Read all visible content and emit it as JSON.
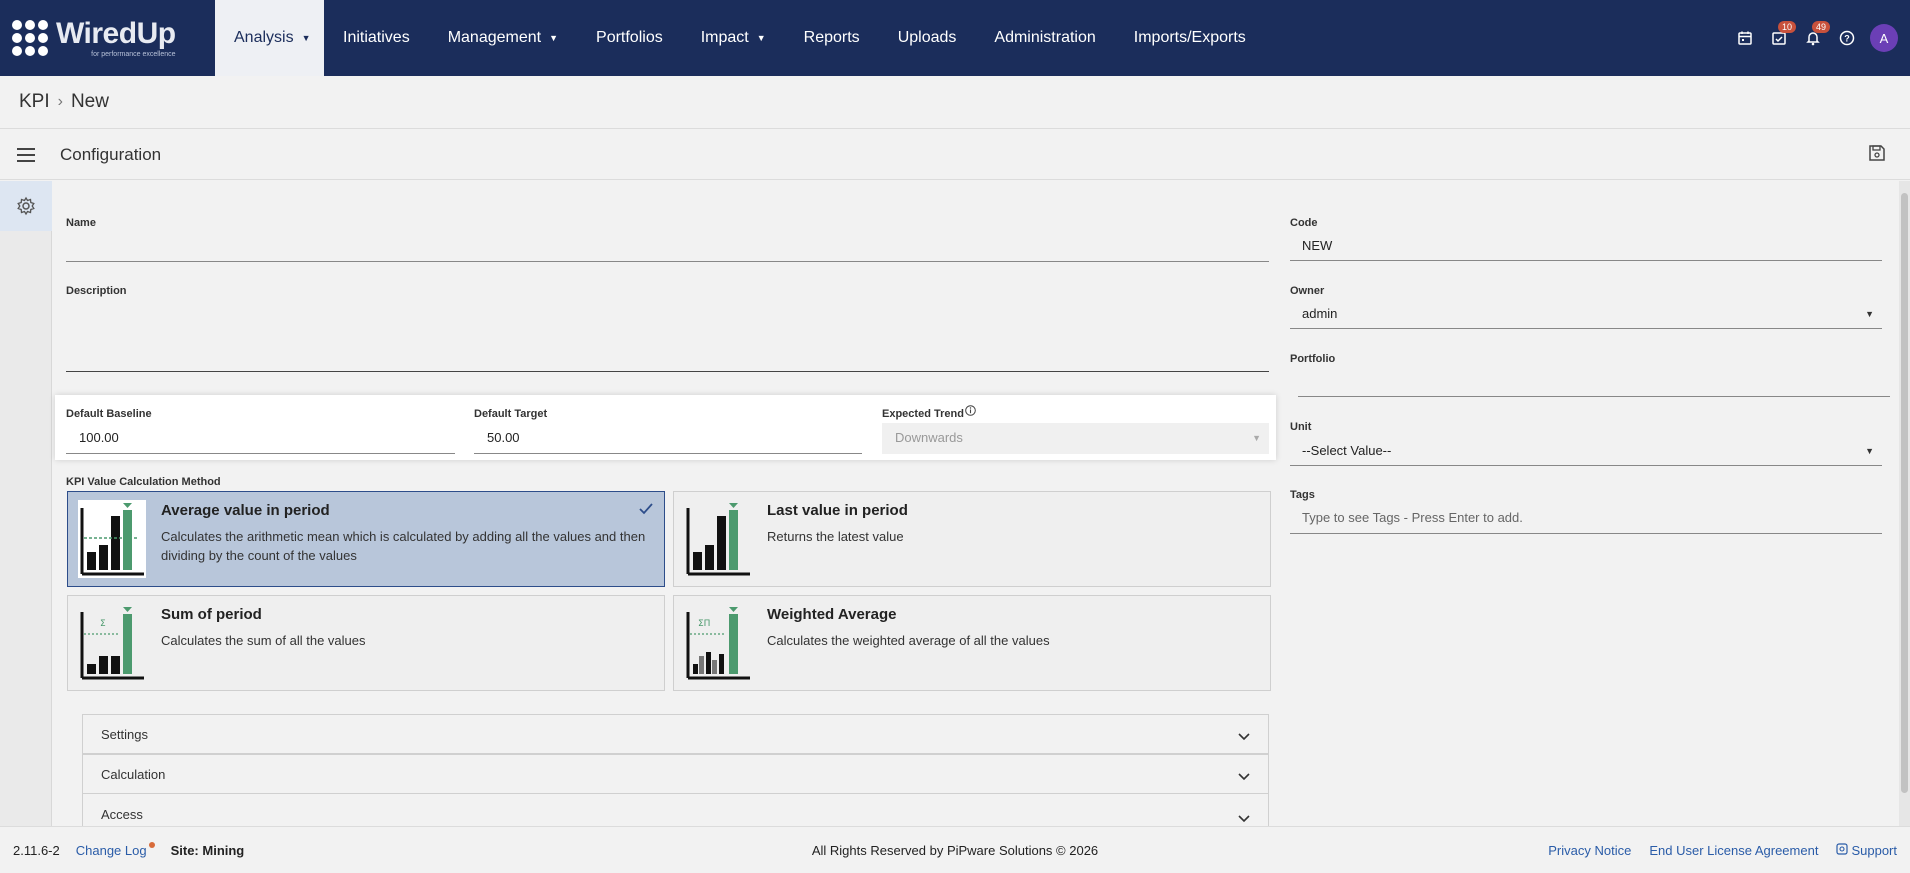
{
  "app": {
    "logo_main": "WiredUp",
    "logo_sub": "for performance excellence"
  },
  "nav": {
    "items": [
      {
        "label": "Analysis",
        "dropdown": true,
        "active": true
      },
      {
        "label": "Initiatives",
        "dropdown": false
      },
      {
        "label": "Management",
        "dropdown": true
      },
      {
        "label": "Portfolios",
        "dropdown": false
      },
      {
        "label": "Impact",
        "dropdown": true
      },
      {
        "label": "Reports",
        "dropdown": false
      },
      {
        "label": "Uploads",
        "dropdown": false
      },
      {
        "label": "Administration",
        "dropdown": false
      },
      {
        "label": "Imports/Exports",
        "dropdown": false
      }
    ],
    "icons": {
      "calendar": "calendar-icon",
      "tasks": "task-check-icon",
      "tasks_badge": "10",
      "notifications": "bell-icon",
      "notifications_badge": "49",
      "help": "help-icon"
    },
    "avatar_initial": "A"
  },
  "breadcrumb": {
    "root": "KPI",
    "current": "New"
  },
  "config": {
    "title": "Configuration"
  },
  "form": {
    "name_label": "Name",
    "name_value": "",
    "description_label": "Description",
    "description_value": "",
    "baseline_label": "Default Baseline",
    "baseline_value": "100.00",
    "target_label": "Default Target",
    "target_value": "50.00",
    "trend_label": "Expected Trend",
    "trend_value": "Downwards",
    "calc_method_label": "KPI Value Calculation Method",
    "code_label": "Code",
    "code_value": "NEW",
    "owner_label": "Owner",
    "owner_value": "admin",
    "portfolio_label": "Portfolio",
    "portfolio_value": "",
    "unit_label": "Unit",
    "unit_value": "--Select Value--",
    "tags_label": "Tags",
    "tags_placeholder": "Type to see Tags - Press Enter to add."
  },
  "calc_methods": [
    {
      "title": "Average value in period",
      "desc": "Calculates the arithmetic mean which is calculated by adding all the values and then dividing by the count of the values",
      "selected": true
    },
    {
      "title": "Last value in period",
      "desc": "Returns the latest value",
      "selected": false
    },
    {
      "title": "Sum of period",
      "desc": "Calculates the sum of all the values",
      "selected": false
    },
    {
      "title": "Weighted Average",
      "desc": "Calculates the weighted average of all the values",
      "selected": false
    }
  ],
  "accordions": [
    {
      "label": "Settings"
    },
    {
      "label": "Calculation"
    },
    {
      "label": "Access"
    }
  ],
  "footer": {
    "version": "2.11.6-2",
    "change_log": "Change Log",
    "site": "Site: Mining",
    "copyright": "All Rights Reserved by PiPware Solutions © 2026",
    "privacy": "Privacy Notice",
    "eula": "End User License Agreement",
    "support": "Support"
  },
  "colors": {
    "nav_bg": "#1b2d5b",
    "selected_card": "#b8c6da",
    "chart_green": "#4c9a6e",
    "link": "#2a5ca8"
  }
}
